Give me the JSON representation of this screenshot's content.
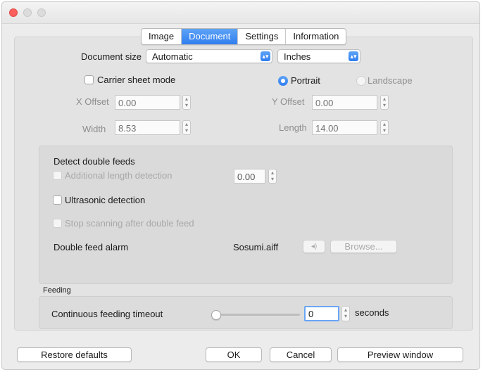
{
  "window": {
    "traffic_lights": {
      "close": "#fc605c",
      "minimize": "#d9d9d9",
      "zoom": "#d9d9d9"
    }
  },
  "tabs": [
    {
      "label": "Image",
      "active": false
    },
    {
      "label": "Document",
      "active": true
    },
    {
      "label": "Settings",
      "active": false
    },
    {
      "label": "Information",
      "active": false
    }
  ],
  "document": {
    "size_label": "Document size",
    "size_value": "Automatic",
    "units_value": "Inches",
    "carrier_label": "Carrier sheet mode",
    "portrait_label": "Portrait",
    "landscape_label": "Landscape",
    "x_offset_label": "X Offset",
    "x_offset_value": "0.00",
    "y_offset_label": "Y Offset",
    "y_offset_value": "0.00",
    "width_label": "Width",
    "width_value": "8.53",
    "length_label": "Length",
    "length_value": "14.00"
  },
  "double_feed": {
    "title": "Detect double feeds",
    "additional_length_label": "Additional length detection",
    "additional_length_value": "0.00",
    "ultrasonic_label": "Ultrasonic detection",
    "stop_scanning_label": "Stop scanning after double feed",
    "alarm_label": "Double feed alarm",
    "alarm_file": "Sosumi.aiff",
    "speaker_icon": "◂)",
    "browse_label": "Browse..."
  },
  "feeding": {
    "section_label": "Feeding",
    "timeout_label": "Continuous feeding timeout",
    "timeout_value": "0",
    "seconds_label": "seconds",
    "slider_position": 0
  },
  "footer": {
    "restore_label": "Restore defaults",
    "ok_label": "OK",
    "cancel_label": "Cancel",
    "preview_label": "Preview window"
  },
  "colors": {
    "accent": "#2f7ef0"
  }
}
